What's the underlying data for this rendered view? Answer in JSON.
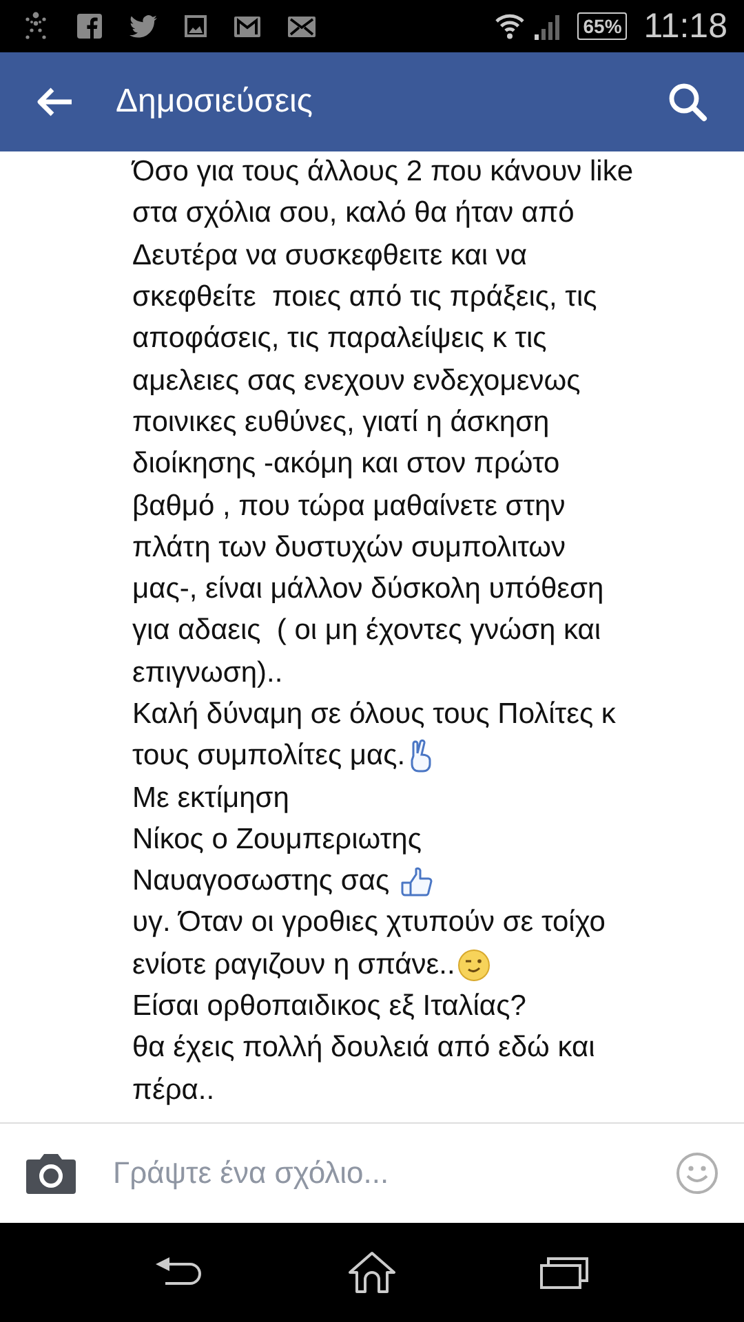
{
  "status_bar": {
    "battery": "65%",
    "time": "11:18"
  },
  "header": {
    "title": "Δημοσιεύσεις"
  },
  "comment_lines": [
    {
      "text": "Όσο για τους άλλους 2 που κάνουν like"
    },
    {
      "text": "στα σχόλια σου, καλό θα ήταν από"
    },
    {
      "text": "Δευτέρα να συσκεφθειτε και να"
    },
    {
      "text": "σκεφθείτε  ποιες από τις πράξεις, τις"
    },
    {
      "text": "αποφάσεις, τις παραλείψεις κ τις"
    },
    {
      "text": "αμελειες σας ενεχουν ενδεχομενως"
    },
    {
      "text": "ποινικες ευθύνες, γιατί η άσκηση"
    },
    {
      "text": "διοίκησης -ακόμη και στον πρώτο"
    },
    {
      "text": "βαθμό , που τώρα μαθαίνετε στην"
    },
    {
      "text": "πλάτη των δυστυχών συμπολιτων"
    },
    {
      "text": "μας-, είναι μάλλον δύσκολη υπόθεση"
    },
    {
      "text": "για αδαεις  ( οι μη έχοντες γνώση και"
    },
    {
      "text": "επιγνωση).."
    },
    {
      "text": "Καλή δύναμη σε όλους τους Πολίτες κ"
    },
    {
      "text": "τους συμπολίτες μας.",
      "kind": "victory"
    },
    {
      "text": "Με εκτίμηση"
    },
    {
      "text": "Νίκος ο Ζουμπεριωτης"
    },
    {
      "text": "Ναυαγοσωστης σας ",
      "kind": "thumbsup"
    },
    {
      "text": "υγ. Όταν οι γροθιες χτυπούν σε τοίχο"
    },
    {
      "text": "ενίοτε ραγιζουν η σπάνε..",
      "kind": "wink"
    },
    {
      "text": "Είσαι ορθοπαιδικος εξ Ιταλίας?"
    },
    {
      "text": "θα έχεις πολλή δουλειά από εδώ και"
    },
    {
      "text": "πέρα.."
    }
  ],
  "comment_bar": {
    "placeholder": "Γράψτε ένα σχόλιο..."
  }
}
